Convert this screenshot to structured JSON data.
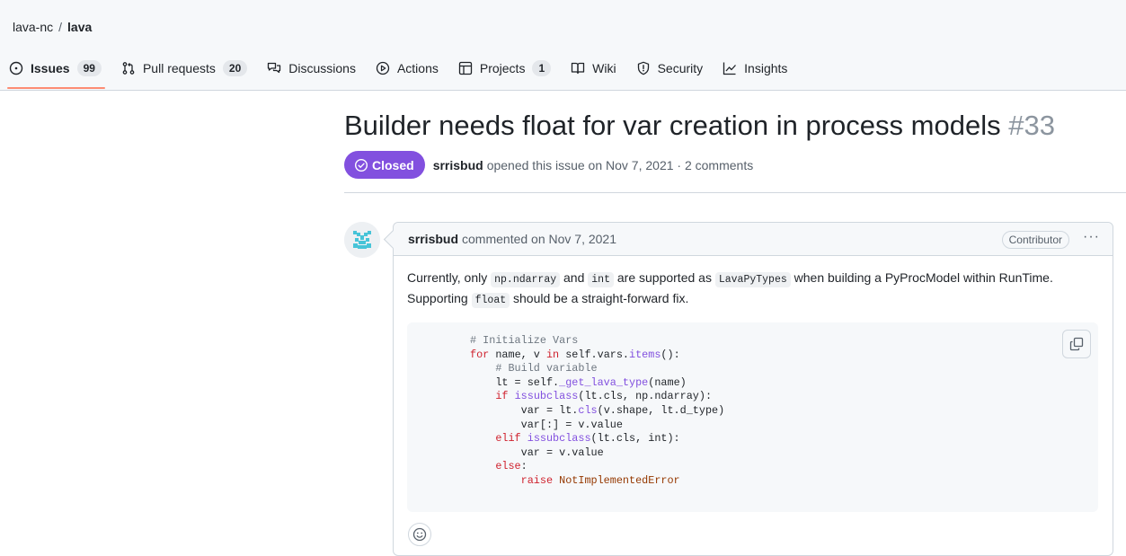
{
  "breadcrumb": {
    "owner": "lava-nc",
    "separator": "/",
    "repo": "lava"
  },
  "nav": {
    "tabs": [
      {
        "label": "Issues",
        "count": "99",
        "icon": "issue-opened-icon",
        "active": true
      },
      {
        "label": "Pull requests",
        "count": "20",
        "icon": "pull-request-icon"
      },
      {
        "label": "Discussions",
        "icon": "discussions-icon"
      },
      {
        "label": "Actions",
        "icon": "play-icon"
      },
      {
        "label": "Projects",
        "count": "1",
        "icon": "table-icon"
      },
      {
        "label": "Wiki",
        "icon": "book-icon"
      },
      {
        "label": "Security",
        "icon": "shield-icon"
      },
      {
        "label": "Insights",
        "icon": "graph-icon"
      }
    ]
  },
  "issue": {
    "title": "Builder needs float for var creation in process models",
    "number": "#33",
    "state": "Closed",
    "author": "srrisbud",
    "meta_text": "opened this issue on Nov 7, 2021 · 2 comments"
  },
  "comment": {
    "author": "srrisbud",
    "header_text": "commented on Nov 7, 2021",
    "role_badge": "Contributor",
    "menu_label": "···",
    "body": {
      "t1": "Currently, only ",
      "c1": "np.ndarray",
      "t2": " and ",
      "c2": "int",
      "t3": " are supported as ",
      "c3": "LavaPyTypes",
      "t4": " when building a PyProcModel within RunTime.",
      "t5": "Supporting ",
      "c4": "float",
      "t6": " should be a straight-forward fix."
    },
    "code": {
      "l1": "# Initialize Vars",
      "l2_kw": "for",
      "l2_a": " name, v ",
      "l2_in": "in",
      "l2_b": " self.vars.",
      "l2_fn": "items",
      "l2_c": "():",
      "l3": "    # Build variable",
      "l4_a": "    lt = self.",
      "l4_fn": "_get_lava_type",
      "l4_b": "(name)",
      "l5_kw": "    if",
      "l5_sp": " ",
      "l5_fn": "issubclass",
      "l5_b": "(lt.cls, np.ndarray):",
      "l6_a": "        var = lt.",
      "l6_fn": "cls",
      "l6_b": "(v.shape, lt.d_type)",
      "l7": "        var[:] = v.value",
      "l8_kw": "    elif",
      "l8_sp": " ",
      "l8_fn": "issubclass",
      "l8_b": "(lt.cls, int):",
      "l9": "        var = v.value",
      "l10_kw": "    else",
      "l10_b": ":",
      "l11_kw": "        raise",
      "l11_sp": " ",
      "l11_err": "NotImplementedError"
    }
  },
  "colors": {
    "closed_badge": "#8250df",
    "active_tab_underline": "#fd8c73",
    "keyword": "#cf222e",
    "function": "#8250df",
    "comment": "#6e7781",
    "exception": "#953800"
  }
}
